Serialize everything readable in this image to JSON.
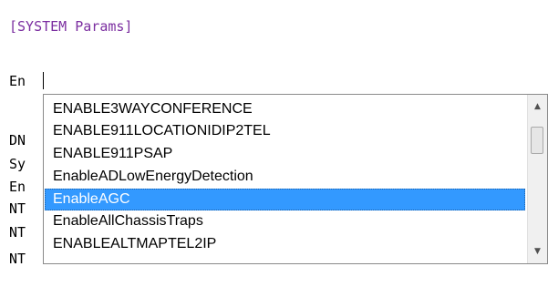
{
  "editor": {
    "section_header": "[SYSTEM Params]",
    "current_line": "En",
    "hidden_lines": [
      "DN",
      "Sy",
      "En",
      "NT",
      "NT",
      "NT"
    ]
  },
  "autocomplete": {
    "items": [
      "ENABLE3WAYCONFERENCE",
      "ENABLE911LOCATIONIDIP2TEL",
      "ENABLE911PSAP",
      "EnableADLowEnergyDetection",
      "EnableAGC",
      "EnableAllChassisTraps",
      "ENABLEALTMAPTEL2IP"
    ],
    "selected_index": 4,
    "selected_color": "#3399ff"
  },
  "scrollbar": {
    "up_icon": "▲",
    "down_icon": "▼"
  }
}
